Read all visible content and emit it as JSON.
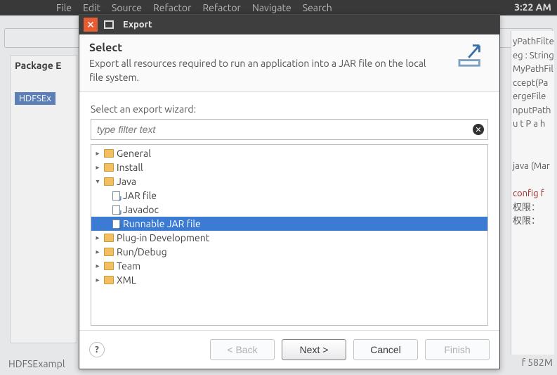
{
  "system": {
    "menus": [
      "File",
      "Edit",
      "Source",
      "Refactor",
      "Refactor",
      "Navigate",
      "Search"
    ],
    "clock": "3:22 AM"
  },
  "eclipse": {
    "package_explorer_title": "Package E",
    "project": "HDFSEx",
    "bottom_file": "HDFSExampl",
    "heap_label": "f 582M",
    "outline_lines": [
      "yPathFilte",
      "eg : String",
      "MyPathFill",
      "ccept(Pa",
      "ergeFile",
      "nputPath",
      "u t P a h"
    ],
    "breadcrumb_label": "java (Mar",
    "console_lines": [
      "config f",
      "权限：",
      "权限："
    ]
  },
  "dialog": {
    "title": "Export",
    "header_title": "Select",
    "header_desc": "Export all resources required to run an application into a JAR file on the local file system.",
    "body_label": "Select an export wizard:",
    "filter_placeholder": "type filter text",
    "tree": {
      "items": [
        {
          "label": "General",
          "level": 0,
          "expanded": false,
          "kind": "folder"
        },
        {
          "label": "Install",
          "level": 0,
          "expanded": false,
          "kind": "folder"
        },
        {
          "label": "Java",
          "level": 0,
          "expanded": true,
          "kind": "folder"
        },
        {
          "label": "JAR file",
          "level": 1,
          "expanded": null,
          "kind": "file"
        },
        {
          "label": "Javadoc",
          "level": 1,
          "expanded": null,
          "kind": "file"
        },
        {
          "label": "Runnable JAR file",
          "level": 1,
          "expanded": null,
          "kind": "file",
          "selected": true
        },
        {
          "label": "Plug-in Development",
          "level": 0,
          "expanded": false,
          "kind": "folder"
        },
        {
          "label": "Run/Debug",
          "level": 0,
          "expanded": false,
          "kind": "folder"
        },
        {
          "label": "Team",
          "level": 0,
          "expanded": false,
          "kind": "folder"
        },
        {
          "label": "XML",
          "level": 0,
          "expanded": false,
          "kind": "folder"
        }
      ]
    },
    "buttons": {
      "back": "< Back",
      "next": "Next >",
      "cancel": "Cancel",
      "finish": "Finish"
    }
  }
}
